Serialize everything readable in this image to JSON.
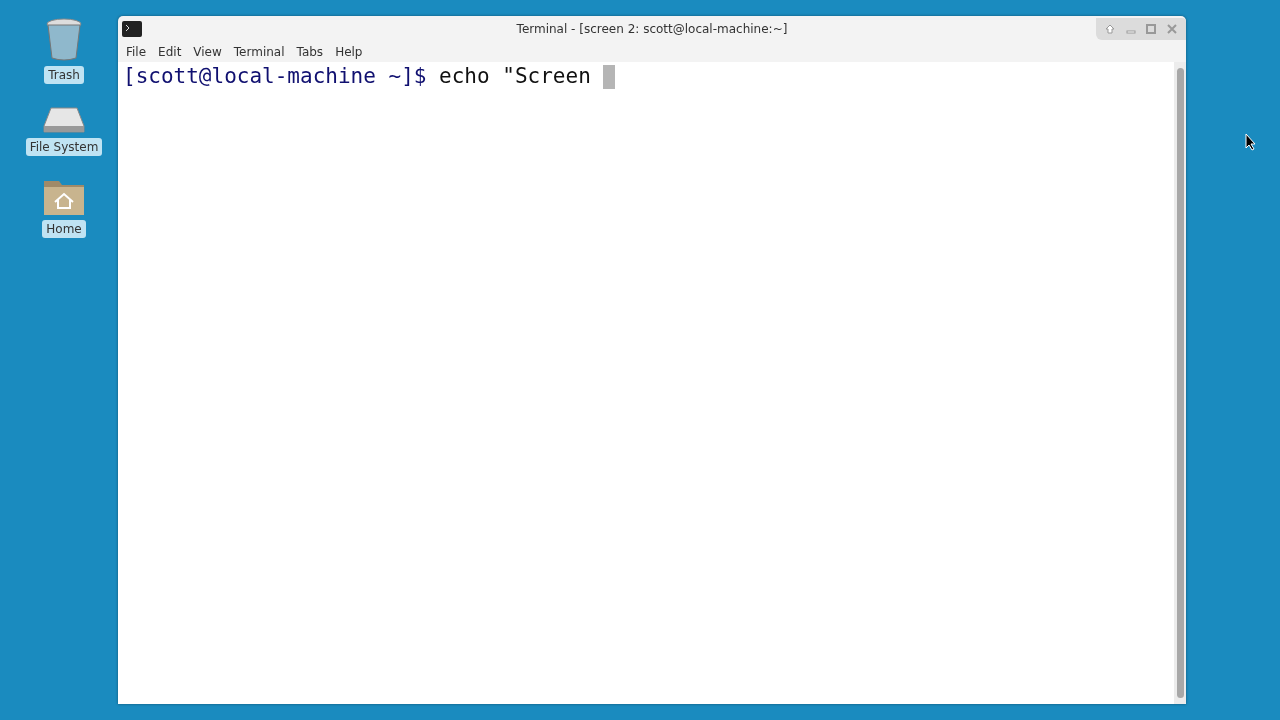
{
  "desktop_icons": [
    {
      "kind": "trash",
      "label": "Trash"
    },
    {
      "kind": "drive",
      "label": "File System"
    },
    {
      "kind": "home",
      "label": "Home"
    }
  ],
  "window": {
    "title": "Terminal - [screen 2: scott@local-machine:~]"
  },
  "menu": [
    "File",
    "Edit",
    "View",
    "Terminal",
    "Tabs",
    "Help"
  ],
  "terminal": {
    "prompt": "[scott@local-machine ~]$",
    "command": "echo \"Screen "
  }
}
